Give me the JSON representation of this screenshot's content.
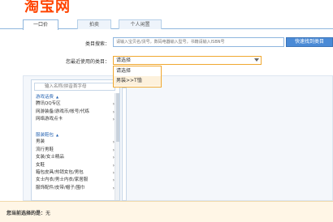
{
  "logo": "淘宝网",
  "tabs": [
    {
      "label": "一口价"
    },
    {
      "label": "拍卖"
    },
    {
      "label": "个人闲置"
    }
  ],
  "search": {
    "label": "类目搜索：",
    "placeholder": "请输入宝贝名/货号，数码电器输入型号，书籍请输入ISBN号",
    "button": "快速找到类目"
  },
  "recent": {
    "label": "您最近使用的类目：",
    "selected": "请选择",
    "options": [
      "请选择",
      "男装>>T恤"
    ]
  },
  "tree": {
    "placeholder": "输入名称/拼音首字母",
    "items": [
      {
        "label": "游戏话费",
        "type": "group"
      },
      {
        "label": "腾讯QQ专区",
        "type": "item"
      },
      {
        "label": "网游装备/游戏币/帐号/代练",
        "type": "item"
      },
      {
        "label": "网络游戏点卡",
        "type": "item"
      },
      {
        "label": "",
        "type": "spacer"
      },
      {
        "label": "服装鞋包",
        "type": "group"
      },
      {
        "label": "男装",
        "type": "item"
      },
      {
        "label": "流行男鞋",
        "type": "item"
      },
      {
        "label": "女装/女士精品",
        "type": "item"
      },
      {
        "label": "女鞋",
        "type": "item"
      },
      {
        "label": "箱包皮具/热销女包/男包",
        "type": "item"
      },
      {
        "label": "女士内衣/男士内衣/家居服",
        "type": "item"
      },
      {
        "label": "服饰配件/皮带/帽子/围巾",
        "type": "item"
      }
    ]
  },
  "bottom": {
    "label": "您当前选择的是：",
    "value": "无"
  },
  "colors": {
    "brand": "#ff4400",
    "accent": "#4a8ad6",
    "select_border": "#f0a830"
  }
}
